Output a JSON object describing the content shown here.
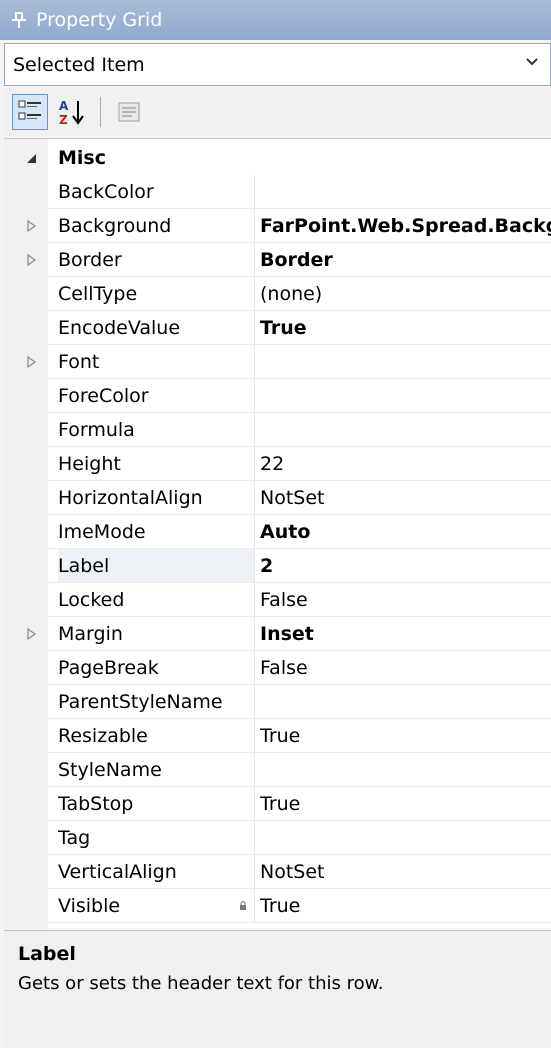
{
  "titlebar": {
    "title": "Property Grid",
    "icon": "pin-icon"
  },
  "selector": {
    "value": "Selected Item"
  },
  "toolbar": {
    "buttons": [
      "categorized-icon",
      "alphabetical-sort-icon",
      "property-pages-icon"
    ]
  },
  "category": {
    "label": "Misc"
  },
  "rows": [
    {
      "name": "BackColor",
      "value": ""
    },
    {
      "name": "Background",
      "value": "FarPoint.Web.Spread.Backg"
    },
    {
      "name": "Border",
      "value": "Border"
    },
    {
      "name": "CellType",
      "value": "(none)"
    },
    {
      "name": "EncodeValue",
      "value": "True"
    },
    {
      "name": "Font",
      "value": ""
    },
    {
      "name": "ForeColor",
      "value": ""
    },
    {
      "name": "Formula",
      "value": ""
    },
    {
      "name": "Height",
      "value": "22"
    },
    {
      "name": "HorizontalAlign",
      "value": "NotSet"
    },
    {
      "name": "ImeMode",
      "value": "Auto"
    },
    {
      "name": "Label",
      "value": "2"
    },
    {
      "name": "Locked",
      "value": "False"
    },
    {
      "name": "Margin",
      "value": "Inset"
    },
    {
      "name": "PageBreak",
      "value": "False"
    },
    {
      "name": "ParentStyleName",
      "value": ""
    },
    {
      "name": "Resizable",
      "value": "True"
    },
    {
      "name": "StyleName",
      "value": ""
    },
    {
      "name": "TabStop",
      "value": "True"
    },
    {
      "name": "Tag",
      "value": ""
    },
    {
      "name": "VerticalAlign",
      "value": "NotSet"
    },
    {
      "name": "Visible",
      "value": "True"
    }
  ],
  "description": {
    "title": "Label",
    "text": "Gets or sets the header text for this row."
  },
  "colors": {
    "titlebar": "#94acd2",
    "selection": "#eef1f5",
    "margin": "#f0f0f0"
  }
}
